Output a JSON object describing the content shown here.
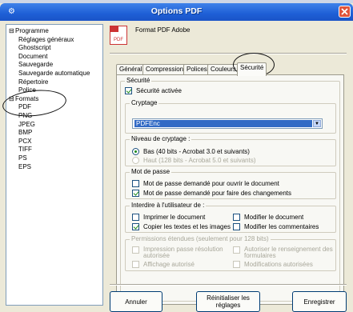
{
  "window": {
    "title": "Options PDF"
  },
  "tree": {
    "nodes": [
      {
        "label": "Programme",
        "level": 0,
        "expander": "⊟"
      },
      {
        "label": "Réglages généraux",
        "level": 1
      },
      {
        "label": "Ghostscript",
        "level": 1
      },
      {
        "label": "Document",
        "level": 1
      },
      {
        "label": "Sauvegarde",
        "level": 1
      },
      {
        "label": "Sauvegarde automatique",
        "level": 1
      },
      {
        "label": "Répertoire",
        "level": 1
      },
      {
        "label": "Police",
        "level": 1
      },
      {
        "label": "Formats",
        "level": 0,
        "expander": "⊟"
      },
      {
        "label": "PDF",
        "level": 1
      },
      {
        "label": "PNG",
        "level": 1
      },
      {
        "label": "JPEG",
        "level": 1
      },
      {
        "label": "BMP",
        "level": 1
      },
      {
        "label": "PCX",
        "level": 1
      },
      {
        "label": "TIFF",
        "level": 1
      },
      {
        "label": "PS",
        "level": 1
      },
      {
        "label": "EPS",
        "level": 1
      }
    ]
  },
  "header": {
    "icon_text": "PDF",
    "title": "Format PDF Adobe"
  },
  "tabs": [
    "Général",
    "Compression",
    "Polices",
    "Couleurs",
    "Sécurité"
  ],
  "active_tab": "Sécurité",
  "security": {
    "group_label": "Sécurité",
    "enable_label": "Sécurité activée",
    "enabled": true,
    "encryption": {
      "label": "Cryptage",
      "selected": "PDFEnc"
    },
    "level": {
      "label": "Niveau de cryptage :",
      "options": [
        {
          "label": "Bas (40 bits - Acrobat 3.0 et suivants)",
          "selected": true,
          "enabled": true
        },
        {
          "label": "Haut (128 bits - Acrobat 5.0 et suivants)",
          "selected": false,
          "enabled": false
        }
      ]
    },
    "password": {
      "label": "Mot de passe",
      "open_label": "Mot de passe demandé pour ouvrir le document",
      "open_checked": false,
      "change_label": "Mot de passe demandé pour faire des changements",
      "change_checked": true
    },
    "restrictions": {
      "label": "Interdire à l'utilisateur de :",
      "print_label": "Imprimer le document",
      "print_checked": false,
      "copy_label": "Copier les textes et les images",
      "copy_checked": true,
      "modify_doc_label": "Modifier le document",
      "modify_doc_checked": false,
      "modify_comments_label": "Modifier les commentaires",
      "modify_comments_checked": false
    },
    "extended": {
      "label": "Permissions étendues (seulement pour 128 bits)",
      "print_res_label": "Impression passe résolution autorisée",
      "fill_forms_label": "Autoriser le renseignement des formulaires",
      "screen_readers_label": "Affichage autorisé",
      "assembly_label": "Modifications autorisées"
    }
  },
  "buttons": {
    "cancel": "Annuler",
    "reset": "Réinitialiser les réglages",
    "save": "Enregistrer"
  }
}
